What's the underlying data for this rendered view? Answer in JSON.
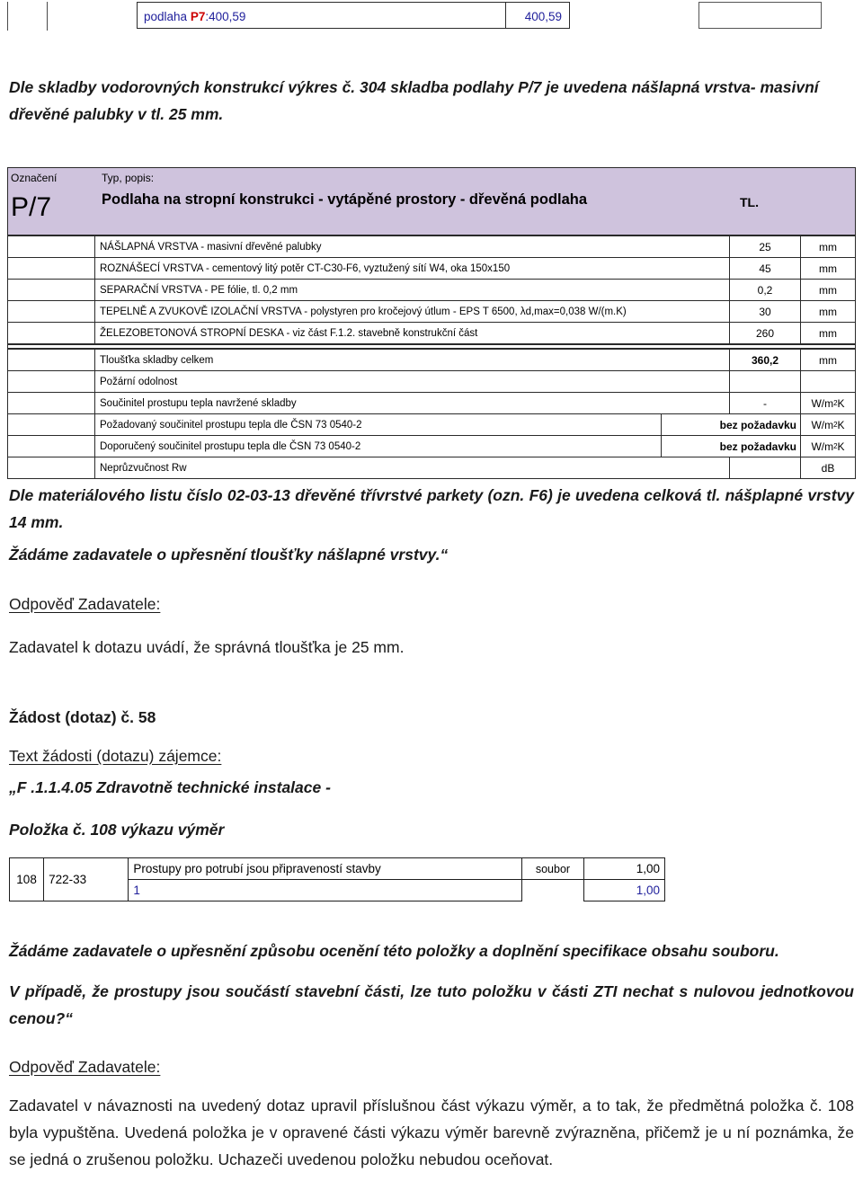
{
  "top_strip": {
    "description": "podlaha P7:400,59",
    "description_prefix": "podlaha ",
    "description_code": "P7",
    "description_suffix": ":400,59",
    "quantity": "400,59",
    "accent_color": "#21219c",
    "code_color": "#cc0000"
  },
  "intro_paragraph": "Dle skladby vodorovných konstrukcí výkres č. 304 skladba podlahy P/7 je uvedena nášlapná vrstva- masivní dřevěné palubky v tl. 25 mm.",
  "composition_table": {
    "header": {
      "code_label": "Označení",
      "code_value": "P/7",
      "type_label": "Typ, popis:",
      "type_value": "Podlaha na stropní konstrukci - vytápěné prostory - dřevěná podlaha",
      "thickness_label": "TL.",
      "background_color": "#cfc3dd"
    },
    "layers": [
      {
        "name": "NÁŠLAPNÁ VRSTVA - masivní dřevěné palubky",
        "value": "25",
        "unit": "mm"
      },
      {
        "name": "ROZNÁŠECÍ VRSTVA - cementový litý potěr CT-C30-F6, vyztužený sítí W4, oka 150x150",
        "value": "45",
        "unit": "mm"
      },
      {
        "name": "SEPARAČNÍ VRSTVA - PE fólie, tl. 0,2 mm",
        "value": "0,2",
        "unit": "mm"
      },
      {
        "name": "TEPELNĚ A ZVUKOVĚ IZOLAČNÍ VRSTVA - polystyren pro kročejový útlum - EPS T 6500, λd,max=0,038 W/(m.K)",
        "value": "30",
        "unit": "mm"
      },
      {
        "name": "ŽELEZOBETONOVÁ STROPNÍ DESKA - viz část F.1.2. stavebně konstrukční část",
        "value": "260",
        "unit": "mm"
      }
    ],
    "summary": [
      {
        "name": "Tloušťka skladby celkem",
        "value": "360,2",
        "unit": "mm",
        "bold": true
      },
      {
        "name": "Požární odolnost",
        "value": "",
        "unit": "",
        "bold": false
      },
      {
        "name": "Součinitel prostupu tepla navržené skladby",
        "value": "-",
        "unit": "W/m2K",
        "bold": false
      },
      {
        "name": "Požadovaný součinitel prostupu tepla dle ČSN 73 0540-2",
        "value": "bez požadavku",
        "unit": "W/m2K",
        "bold": true
      },
      {
        "name": "Doporučený součinitel prostupu tepla dle ČSN 73 0540-2",
        "value": "bez požadavku",
        "unit": "W/m2K",
        "bold": true
      },
      {
        "name": "Neprůzvučnost Rw",
        "value": "",
        "unit": "dB",
        "bold": false
      }
    ]
  },
  "material_paragraph": "Dle materiálového listu číslo 02-03-13 dřevěné třívrstvé parkety (ozn. F6) je uvedena celková tl. nášplapné vrstvy 14 mm.",
  "request_paragraph_1": "Žádáme zadavatele o upřesnění tloušťky nášlapné vrstvy.“",
  "answer_heading_1": "Odpověď Zadavatele:",
  "answer_text_1": "Zadavatel k dotazu uvádí, že správná tloušťka je 25 mm.",
  "request_heading": "Žádost (dotaz) č. 58",
  "request_subheading": "Text žádosti (dotazu) zájemce:",
  "request_line_1": "„F .1.1.4.05 Zdravotně technické instalace -",
  "request_line_2": "Položka č. 108 výkazu výměr",
  "vv_table": {
    "row_main": {
      "number": "108",
      "code": "722-33",
      "description": "Prostupy pro potrubí jsou připraveností stavby",
      "unit": "soubor",
      "quantity": "1,00"
    },
    "row_sub": {
      "formula": "1",
      "quantity": "1,00"
    },
    "blue_color": "#21219c"
  },
  "request_paragraph_2": "Žádáme zadavatele o upřesnění způsobu ocenění této položky a doplnění specifikace obsahu souboru.",
  "request_paragraph_3": "V případě, že prostupy jsou součástí stavební části, lze tuto položku v části ZTI nechat s nulovou jednotkovou cenou?“",
  "answer_heading_2": "Odpověď Zadavatele:",
  "answer_text_2": "Zadavatel v návaznosti na uvedený dotaz upravil příslušnou část výkazu výměr, a to tak, že předmětná položka č. 108 byla vypuštěna. Uvedená položka je v opravené části výkazu výměr barevně zvýrazněna, přičemž je u ní poznámka, že se jedná o zrušenou položku. Uchazeči uvedenou položku nebudou oceňovat."
}
